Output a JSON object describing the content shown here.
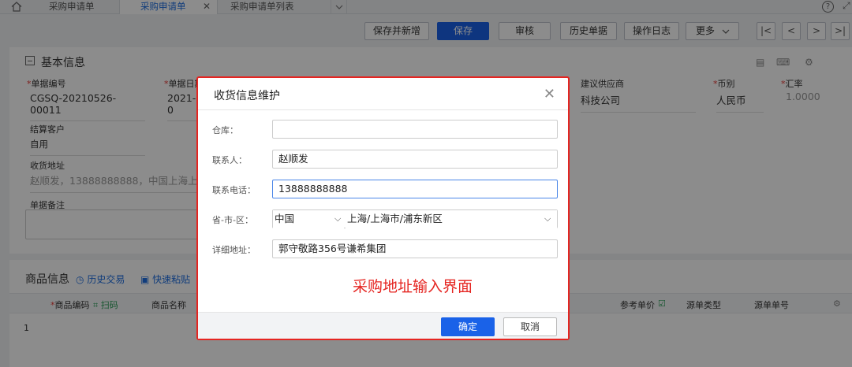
{
  "tabs": [
    {
      "label": "采购申请单"
    },
    {
      "label": "采购申请单"
    },
    {
      "label": "采购申请单列表"
    }
  ],
  "toolbar": {
    "save_new": "保存并新增",
    "save": "保存",
    "audit": "审核",
    "history": "历史单据",
    "log": "操作日志",
    "more": "更多"
  },
  "nav": {
    "first": "|<",
    "prev": "<",
    "next": ">",
    "last": ">|"
  },
  "base_info": {
    "title": "基本信息",
    "doc_no_label": "单据编号",
    "doc_no": "CGSQ-20210526-00011",
    "doc_date_label": "单据日期",
    "doc_date": "2021-0",
    "supplier_label": "建议供应商",
    "supplier": "科技公司",
    "currency_label": "币别",
    "currency": "人民币",
    "rate_label": "汇率",
    "rate": "1.0000",
    "customer_label": "结算客户",
    "customer": "自用",
    "address_label": "收货地址",
    "address": "赵顺发，13888888888，中国上海上海",
    "memo_label": "单据备注"
  },
  "goods": {
    "title": "商品信息",
    "history_link": "历史交易",
    "paste_link": "快速粘贴",
    "col_code": "商品编码",
    "col_scan": "扫码",
    "col_name": "商品名称",
    "col_ref_price": "参考单价",
    "col_src_type": "源单类型",
    "col_src_no": "源单单号",
    "row1": "1"
  },
  "dialog": {
    "title": "收货信息维护",
    "warehouse_label": "仓库：",
    "warehouse": "",
    "contact_label": "联系人：",
    "contact": "赵顺发",
    "phone_label": "联系电话：",
    "phone": "13888888888",
    "region_label": "省-市-区：",
    "country": "中国",
    "region": "上海/上海市/浦东新区",
    "detail_label": "详细地址：",
    "detail": "郭守敬路356号谦希集团",
    "annotation": "采购地址输入界面",
    "ok": "确定",
    "cancel": "取消"
  },
  "colors": {
    "primary": "#1a62e8",
    "annotation_red": "#e52521",
    "tab_active": "#1e6ee0"
  }
}
